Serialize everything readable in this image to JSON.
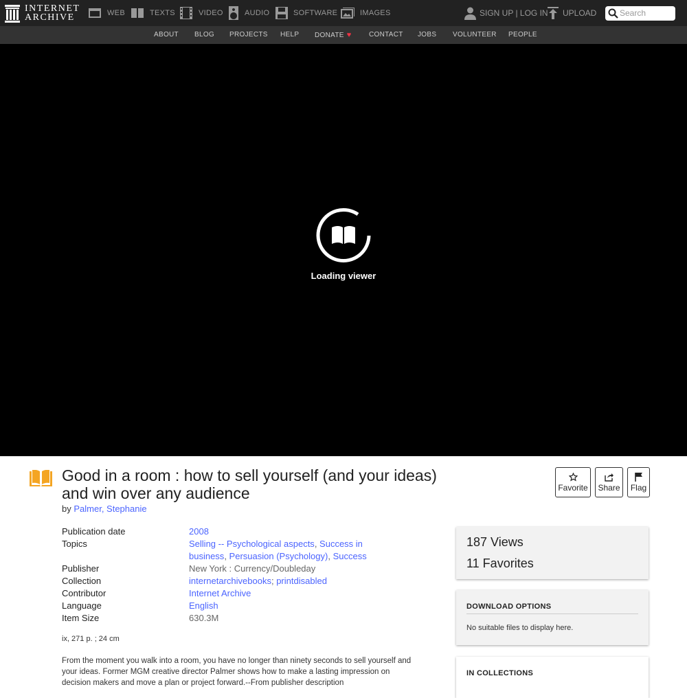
{
  "topbar": {
    "logo_line1": "INTERNET",
    "logo_line2": "ARCHIVE",
    "nav": [
      {
        "label": "WEB",
        "icon": "web-icon"
      },
      {
        "label": "TEXTS",
        "icon": "texts-icon"
      },
      {
        "label": "VIDEO",
        "icon": "video-icon"
      },
      {
        "label": "AUDIO",
        "icon": "audio-icon"
      },
      {
        "label": "SOFTWARE",
        "icon": "software-icon"
      },
      {
        "label": "IMAGES",
        "icon": "images-icon"
      }
    ],
    "user_label": "SIGN UP | LOG IN",
    "upload_label": "UPLOAD",
    "search_placeholder": "Search"
  },
  "subnav": [
    "ABOUT",
    "BLOG",
    "PROJECTS",
    "HELP",
    "DONATE",
    "CONTACT",
    "JOBS",
    "VOLUNTEER",
    "PEOPLE"
  ],
  "viewer": {
    "loading_text": "Loading viewer"
  },
  "item": {
    "title": "Good in a room : how to sell yourself (and your ideas) and win over any audience",
    "by_prefix": "by",
    "author": "Palmer, Stephanie",
    "actions": [
      "Favorite",
      "Share",
      "Flag"
    ],
    "metadata": [
      {
        "key": "Publication date",
        "values": [
          {
            "text": "2008",
            "link": true
          }
        ]
      },
      {
        "key": "Topics",
        "values": [
          {
            "text": "Selling -- Psychological aspects",
            "link": true
          },
          {
            "text": "Success in business",
            "link": true
          },
          {
            "text": "Persuasion (Psychology)",
            "link": true
          },
          {
            "text": "Success",
            "link": true
          }
        ],
        "sep": ", "
      },
      {
        "key": "Publisher",
        "values": [
          {
            "text": "New York : Currency/Doubleday",
            "link": false
          }
        ]
      },
      {
        "key": "Collection",
        "values": [
          {
            "text": "internetarchivebooks",
            "link": true
          },
          {
            "text": "printdisabled",
            "link": true
          }
        ],
        "sep": "; "
      },
      {
        "key": "Contributor",
        "values": [
          {
            "text": "Internet Archive",
            "link": true
          }
        ]
      },
      {
        "key": "Language",
        "values": [
          {
            "text": "English",
            "link": true
          }
        ]
      },
      {
        "key": "Item Size",
        "values": [
          {
            "text": "630.3M",
            "link": false
          }
        ]
      }
    ],
    "physical": "ix, 271 p. ; 24 cm",
    "description": "From the moment you walk into a room, you have no longer than ninety seconds to sell yourself and your ideas. Former MGM creative director Palmer shows how to make a lasting impression on decision makers and move a plan or project forward.--From publisher description"
  },
  "sidebar": {
    "views": "187 Views",
    "favorites": "11 Favorites",
    "download_heading": "DOWNLOAD OPTIONS",
    "download_note": "No suitable files to display here.",
    "collections_heading": "IN COLLECTIONS"
  },
  "colors": {
    "topbar": "#222222",
    "subbar": "#333333",
    "link": "#4b64ff",
    "texts_icon": "#f4a523",
    "heart": "#ee3344"
  }
}
